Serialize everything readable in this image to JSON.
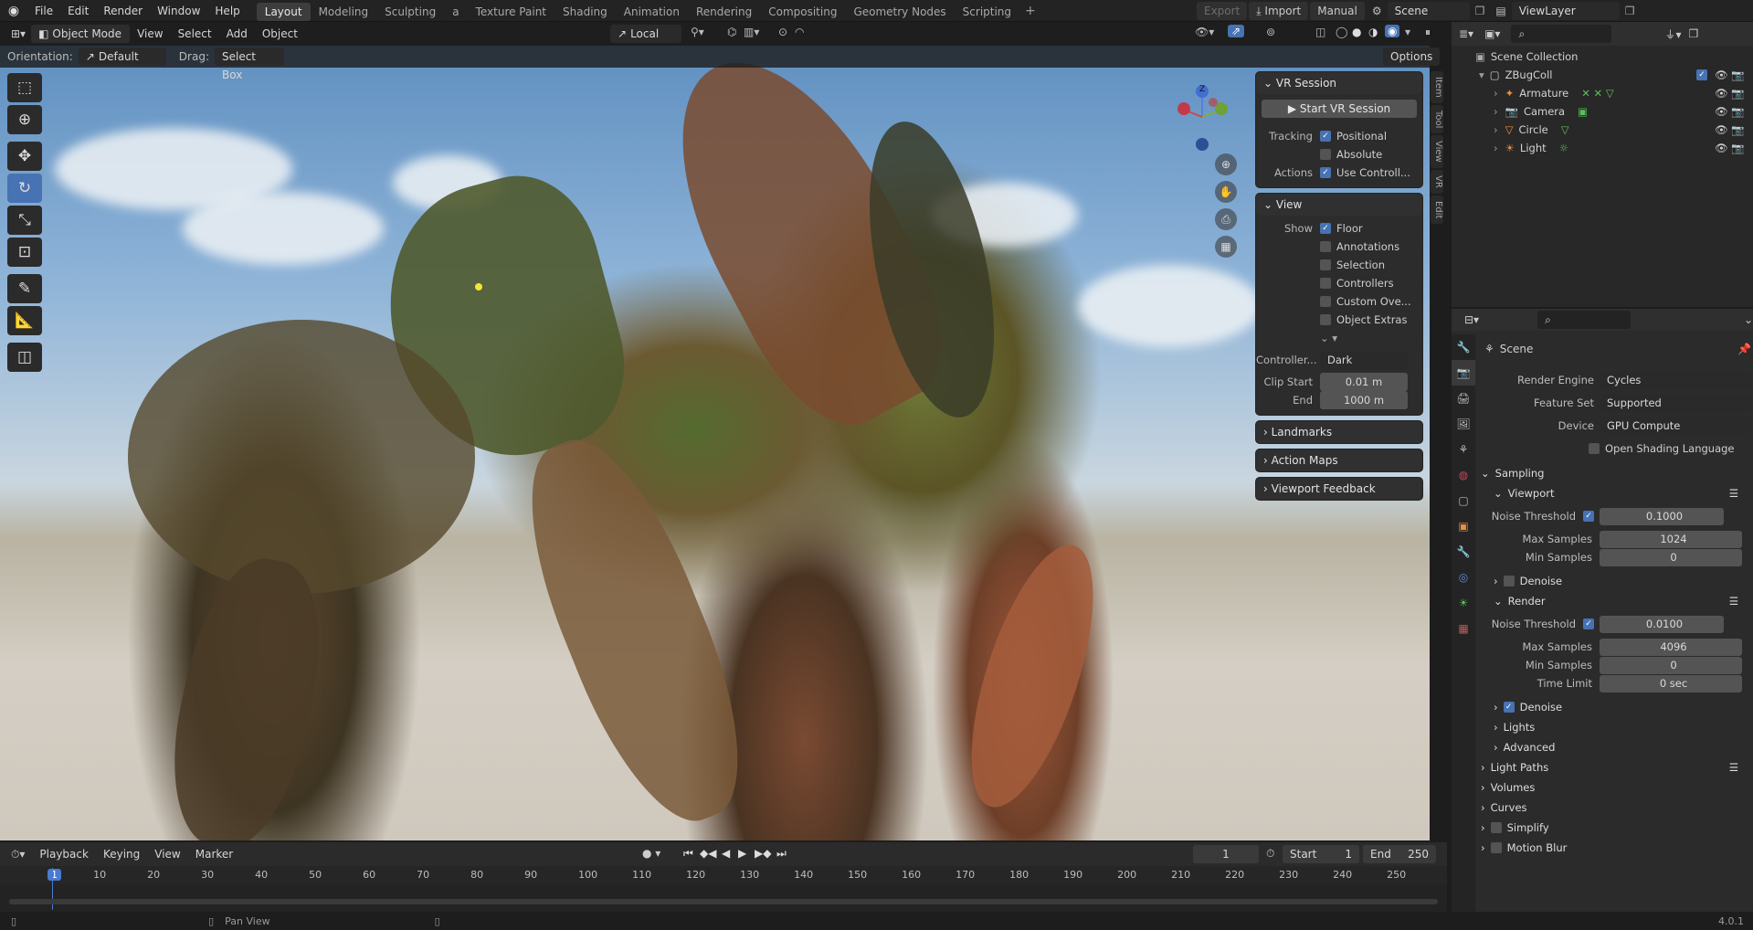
{
  "menus": [
    "File",
    "Edit",
    "Render",
    "Window",
    "Help"
  ],
  "workspaces": [
    {
      "label": "Layout",
      "active": true
    },
    {
      "label": "Modeling"
    },
    {
      "label": "Sculpting"
    },
    {
      "label": "a"
    },
    {
      "label": "Texture Paint"
    },
    {
      "label": "Shading"
    },
    {
      "label": "Animation"
    },
    {
      "label": "Rendering"
    },
    {
      "label": "Compositing"
    },
    {
      "label": "Geometry Nodes"
    },
    {
      "label": "Scripting"
    }
  ],
  "topright": {
    "export": "Export",
    "import": "Import",
    "manual": "Manual",
    "scene": "Scene",
    "viewlayer": "ViewLayer"
  },
  "viewport_header": {
    "mode": "Object Mode",
    "view": "View",
    "select": "Select",
    "add": "Add",
    "object": "Object",
    "transform_orientation": "Local",
    "orientation_label": "Orientation:",
    "orientation_value": "Default",
    "drag_label": "Drag:",
    "drag_value": "Select Box",
    "options": "Options"
  },
  "gizmo_axis": "Z",
  "vr_panel": {
    "title": "VR Session",
    "start_button": "Start VR Session",
    "tracking_label": "Tracking",
    "positional": "Positional",
    "absolute": "Absolute",
    "actions_label": "Actions",
    "use_controllers": "Use Controll...",
    "view_title": "View",
    "show_label": "Show",
    "show_items": [
      {
        "label": "Floor",
        "checked": true
      },
      {
        "label": "Annotations",
        "checked": false
      },
      {
        "label": "Selection",
        "checked": false
      },
      {
        "label": "Controllers",
        "checked": false
      },
      {
        "label": "Custom Ove...",
        "checked": false
      },
      {
        "label": "Object Extras",
        "checked": false
      }
    ],
    "controller_label": "Controller...",
    "controller_value": "Dark",
    "clip_start_label": "Clip Start",
    "clip_start_value": "0.01 m",
    "clip_end_label": "End",
    "clip_end_value": "1000 m",
    "collapsed": [
      "Landmarks",
      "Action Maps",
      "Viewport Feedback"
    ]
  },
  "side_tabs": [
    "Item",
    "Tool",
    "View",
    "VR",
    "Edit"
  ],
  "outliner": {
    "root": "Scene Collection",
    "collection": "ZBugColl",
    "items": [
      {
        "label": "Armature"
      },
      {
        "label": "Camera"
      },
      {
        "label": "Circle"
      },
      {
        "label": "Light"
      }
    ]
  },
  "properties": {
    "context": "Scene",
    "render_engine_label": "Render Engine",
    "render_engine": "Cycles",
    "feature_set_label": "Feature Set",
    "feature_set": "Supported",
    "device_label": "Device",
    "device": "GPU Compute",
    "osl_label": "Open Shading Language",
    "sampling": "Sampling",
    "viewport": "Viewport",
    "noise_threshold_label": "Noise Threshold",
    "vp_noise_threshold": "0.1000",
    "max_samples_label": "Max Samples",
    "vp_max_samples": "1024",
    "min_samples_label": "Min Samples",
    "vp_min_samples": "0",
    "denoise": "Denoise",
    "render": "Render",
    "r_noise_threshold": "0.0100",
    "r_max_samples": "4096",
    "r_min_samples": "0",
    "time_limit_label": "Time Limit",
    "time_limit": "0 sec",
    "lights": "Lights",
    "advanced": "Advanced",
    "light_paths": "Light Paths",
    "volumes": "Volumes",
    "curves": "Curves",
    "simplify": "Simplify",
    "motion_blur": "Motion Blur"
  },
  "timeline": {
    "playback": "Playback",
    "keying": "Keying",
    "view": "View",
    "marker": "Marker",
    "current_frame": "1",
    "start_label": "Start",
    "start": "1",
    "end_label": "End",
    "end": "250",
    "ticks": [
      "1",
      "10",
      "20",
      "30",
      "40",
      "50",
      "60",
      "70",
      "80",
      "90",
      "100",
      "110",
      "120",
      "130",
      "140",
      "150",
      "160",
      "170",
      "180",
      "190",
      "200",
      "210",
      "220",
      "230",
      "240",
      "250"
    ]
  },
  "status": {
    "pan_view": "Pan View",
    "version": "4.0.1"
  }
}
